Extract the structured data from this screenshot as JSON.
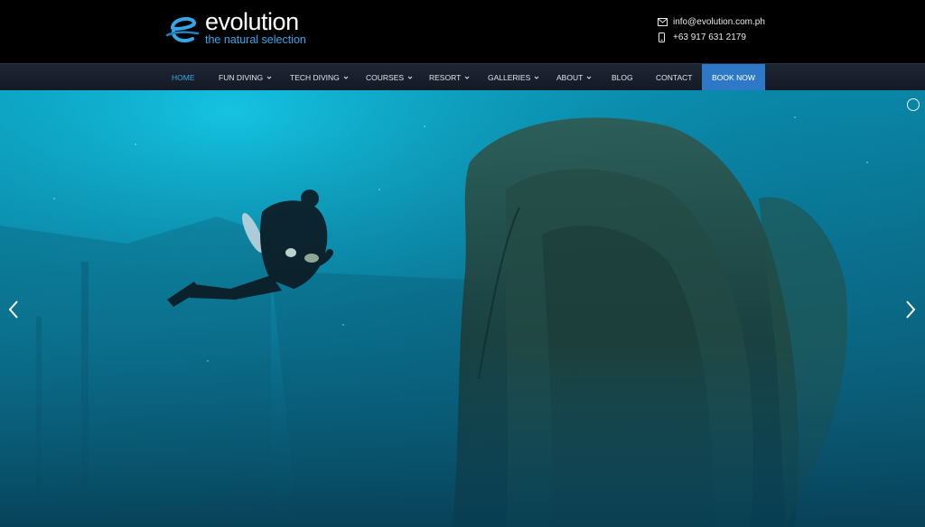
{
  "brand": {
    "name": "evolution",
    "tagline": "the natural selection",
    "accent": "#33a7e8"
  },
  "contact": {
    "email": "info@evolution.com.ph",
    "phone": "+63 917 631 2179",
    "email_icon": "envelope-icon",
    "phone_icon": "mobile-phone-icon"
  },
  "nav": {
    "items": [
      {
        "label": "HOME",
        "active": true
      },
      {
        "label": "FUN DIVING"
      },
      {
        "label": "TECH DIVING"
      },
      {
        "label": "COURSES"
      },
      {
        "label": "RESORT"
      },
      {
        "label": "GALLERIES"
      },
      {
        "label": "ABOUT"
      },
      {
        "label": "BLOG"
      },
      {
        "label": "CONTACT"
      }
    ],
    "book_label": "BOOK NOW",
    "book_color": "#2d79c7"
  },
  "slider": {
    "prev_icon": "chevron-left-icon",
    "next_icon": "chevron-right-icon",
    "pager_icon": "slide-dot-icon"
  }
}
